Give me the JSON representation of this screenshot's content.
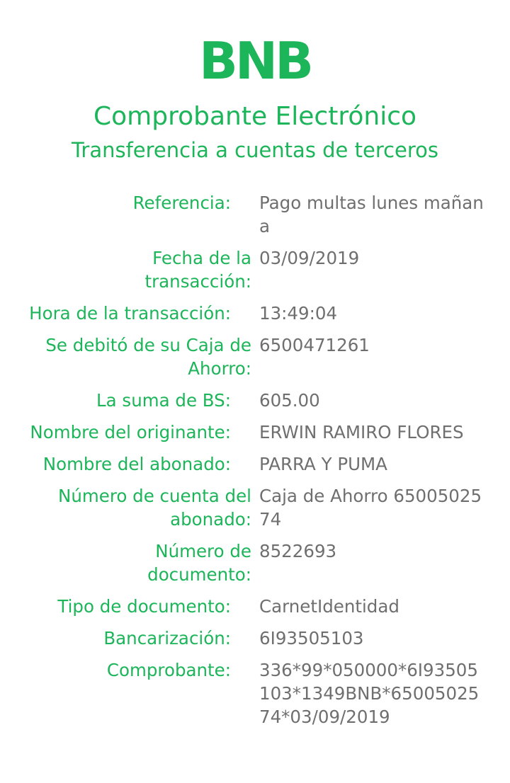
{
  "header": {
    "logo_text": "BNB",
    "title": "Comprobante Electrónico",
    "subtitle": "Transferencia a cuentas de terceros"
  },
  "colors": {
    "brand_green": "#1db55a",
    "value_gray": "#6f6f6f"
  },
  "details": [
    {
      "label": "Referencia:",
      "value": "Pago multas lunes mañana"
    },
    {
      "label": "Fecha de la transacción:",
      "value": "03/09/2019"
    },
    {
      "label": "Hora de la transacción:",
      "value": "13:49:04"
    },
    {
      "label": "Se debitó de su Caja de Ahorro:",
      "value": "6500471261"
    },
    {
      "label": "La suma de BS:",
      "value": "605.00"
    },
    {
      "label": "Nombre del originante:",
      "value": "ERWIN RAMIRO FLORES"
    },
    {
      "label": "Nombre del abonado:",
      "value": "PARRA Y PUMA"
    },
    {
      "label": "Número de cuenta del abonado:",
      "value": "Caja de Ahorro 6500502574"
    },
    {
      "label": "Número de documento:",
      "value": "8522693"
    },
    {
      "label": "Tipo de documento:",
      "value": "CarnetIdentidad"
    },
    {
      "label": "Bancarización:",
      "value": "6I93505103"
    },
    {
      "label": "Comprobante:",
      "value": "336*99*050000*6I93505103*1349BNB*6500502574*03/09/2019"
    }
  ]
}
